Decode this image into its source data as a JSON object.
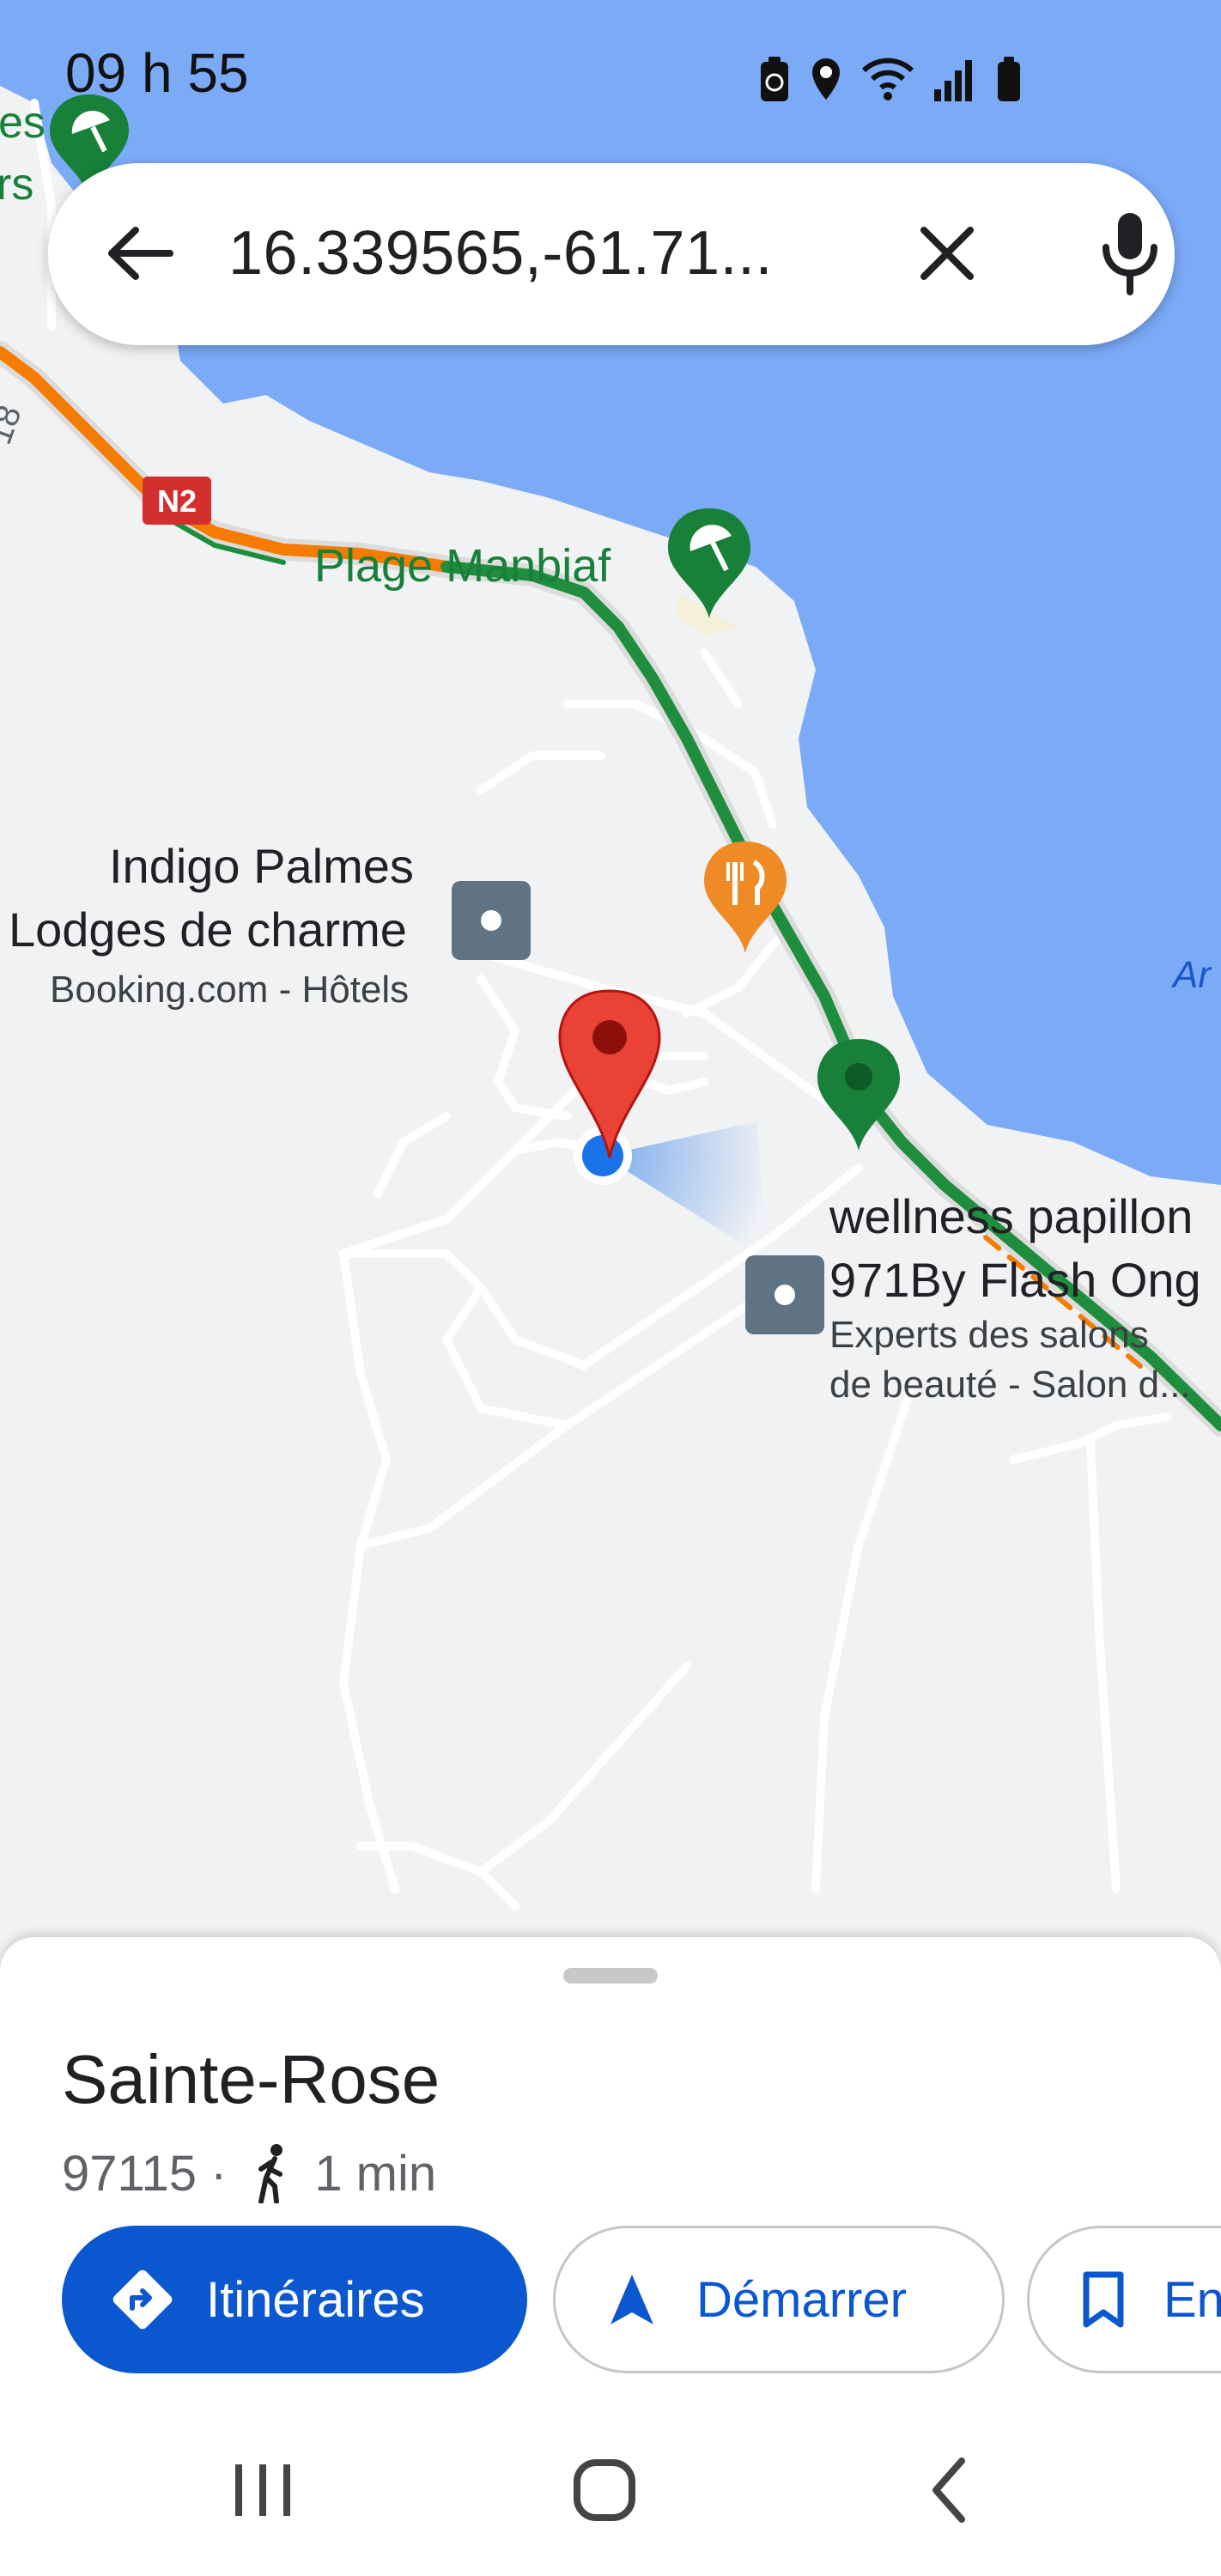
{
  "status_bar": {
    "time": "09 h 55",
    "icons": [
      "battery-saver-icon",
      "location-icon",
      "wifi-icon",
      "signal-icon",
      "battery-icon"
    ]
  },
  "search": {
    "query": "16.339565,-61.71...",
    "icons": [
      "back-arrow-icon",
      "clear-icon",
      "microphone-icon"
    ]
  },
  "map": {
    "road_badge": "N2",
    "edge_fragments": {
      "top_left_1": "es",
      "top_left_2": "rs",
      "side_road": "18",
      "right_edge": "Ar"
    },
    "places": [
      {
        "name": "Plage Manbiaf",
        "category_icon": "beach-umbrella-icon",
        "color": "#188038"
      },
      {
        "name_line1": "Indigo Palmes",
        "name_line2": "Lodges de charme",
        "subtitle": "Booking.com - Hôtels",
        "category_icon": "hotel-square-icon"
      },
      {
        "name_line1": "wellness papillon",
        "name_line2": "971By Flash Ong",
        "subtitle_line1": "Experts des salons",
        "subtitle_line2": "de beauté - Salon d...",
        "category_icon": "salon-square-icon"
      }
    ],
    "markers": [
      "restaurant-pin-icon",
      "green-place-pin-icon",
      "dropped-red-pin-icon",
      "my-location-dot-icon"
    ],
    "colors": {
      "sea": "#7baaf7",
      "land": "#f1f2f4",
      "road_traffic_green": "#1e8e3e",
      "road_traffic_orange": "#f57c00",
      "restaurant_pin": "#f08a24",
      "dropped_pin": "#ea4335",
      "my_location": "#1a73e8"
    }
  },
  "place_sheet": {
    "title": "Sainte-Rose",
    "postcode": "97115",
    "separator": "·",
    "walk_time": "1 min",
    "actions": [
      {
        "label": "Itinéraires",
        "icon": "directions-icon",
        "style": "primary"
      },
      {
        "label": "Démarrer",
        "icon": "navigation-arrow-icon",
        "style": "outline"
      },
      {
        "label": "Enregistrer",
        "icon": "bookmark-icon",
        "style": "outline"
      }
    ],
    "accent_color": "#0b57d0"
  },
  "nav_bar": {
    "icons": [
      "recent-apps-icon",
      "home-icon",
      "back-icon"
    ]
  }
}
